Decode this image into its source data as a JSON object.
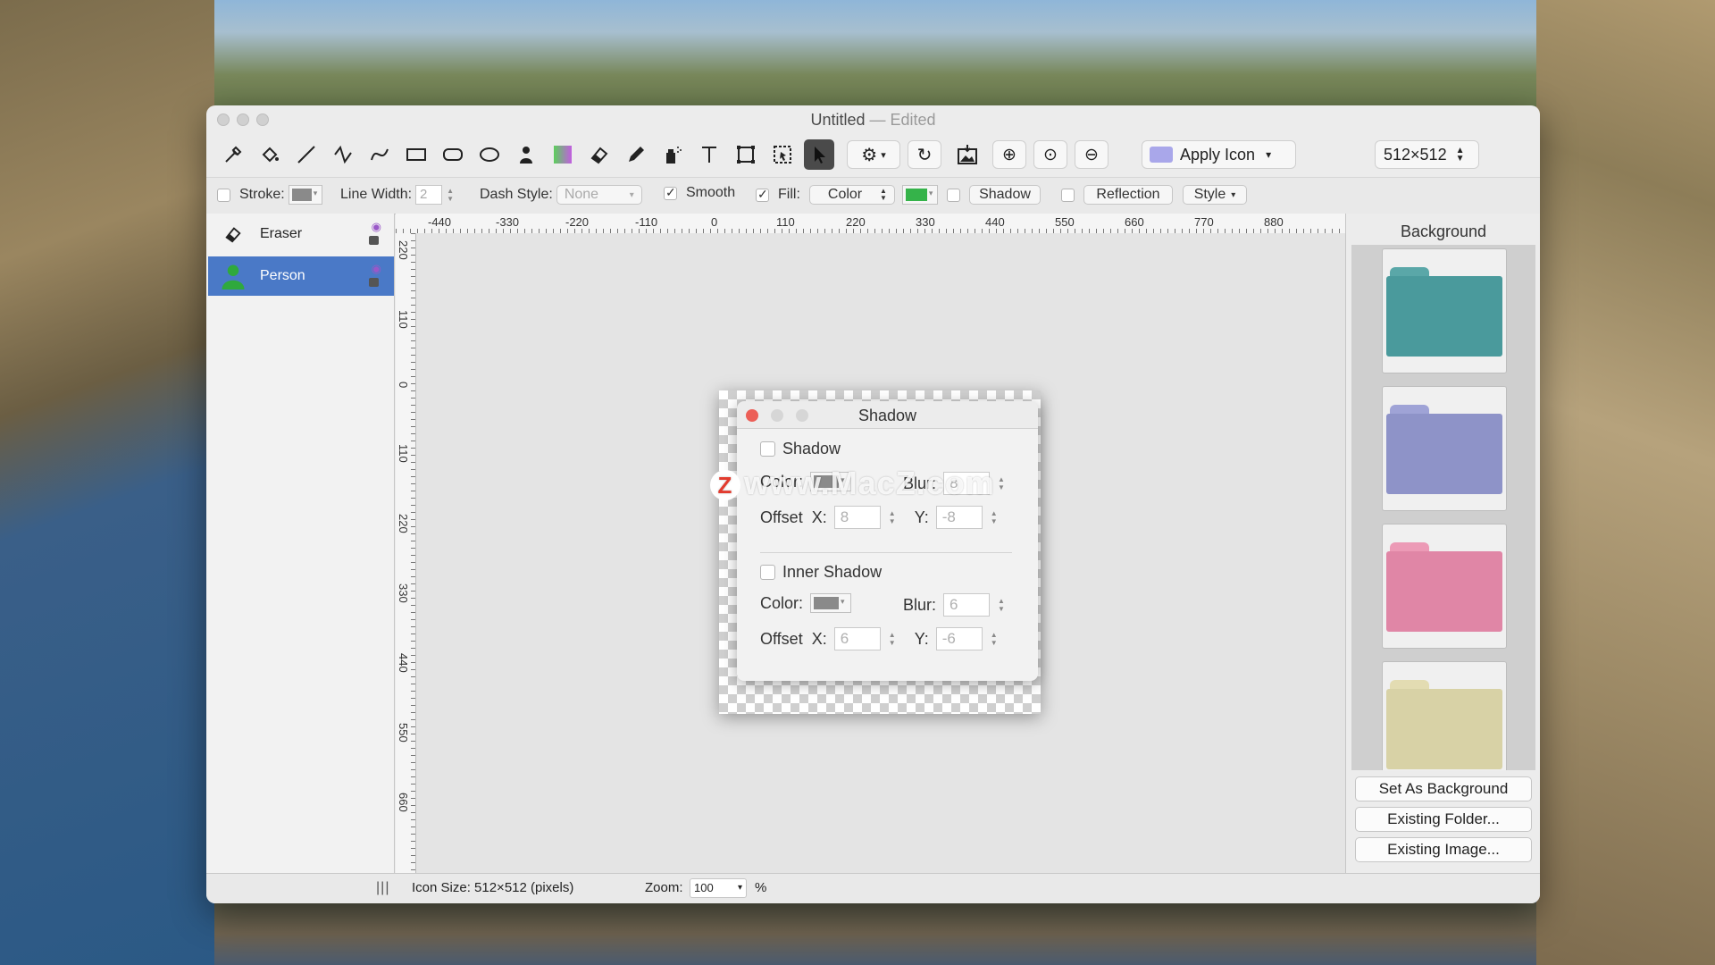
{
  "window": {
    "title": "Untitled",
    "title_status": "— Edited"
  },
  "toolbar": {
    "apply_icon_label": "Apply Icon",
    "size_label": "512×512",
    "tools": [
      "eyedropper-icon",
      "paint-bucket-icon",
      "line-icon",
      "polyline-icon",
      "curve-icon",
      "rectangle-icon",
      "rounded-rect-icon",
      "ellipse-icon",
      "person-icon",
      "gradient-icon",
      "eraser-icon",
      "pencil-icon",
      "spray-icon",
      "text-icon",
      "transform-icon",
      "selection-icon",
      "arrow-icon"
    ]
  },
  "options": {
    "stroke_label": "Stroke:",
    "line_width_label": "Line Width:",
    "line_width_value": "2",
    "dash_style_label": "Dash Style:",
    "dash_style_value": "None",
    "smooth_label": "Smooth",
    "fill_label": "Fill:",
    "fill_value": "Color",
    "shadow_label": "Shadow",
    "reflection_label": "Reflection",
    "style_label": "Style",
    "fill_color": "#35b34a"
  },
  "layers": [
    {
      "name": "Eraser",
      "selected": false
    },
    {
      "name": "Person",
      "selected": true
    }
  ],
  "ruler": {
    "h_ticks": [
      "-440",
      "-330",
      "-220",
      "-110",
      "0",
      "110",
      "220",
      "330",
      "440",
      "550",
      "660",
      "770",
      "880"
    ],
    "v_ticks": [
      "220",
      "110",
      "0",
      "110",
      "220",
      "330",
      "440",
      "550",
      "660"
    ]
  },
  "background_panel": {
    "title": "Background",
    "folders": [
      {
        "color": "#4a9a9c",
        "tab": "#5aa7a8"
      },
      {
        "color": "#8e93c8",
        "tab": "#9fa3d6"
      },
      {
        "color": "#e086a6",
        "tab": "#ec9ab6"
      },
      {
        "color": "#d8d2a6",
        "tab": "#e3dcb2"
      }
    ],
    "set_bg_label": "Set As Background",
    "existing_folder_label": "Existing Folder...",
    "existing_image_label": "Existing Image..."
  },
  "status": {
    "icon_size": "Icon Size: 512×512 (pixels)",
    "zoom_label": "Zoom:",
    "zoom_value": "100",
    "zoom_unit": "%"
  },
  "shadow_dialog": {
    "title": "Shadow",
    "shadow_label": "Shadow",
    "color_label": "Color:",
    "blur_label": "Blur:",
    "blur_value": "8",
    "offset_label": "Offset",
    "x_label": "X:",
    "offset_x": "8",
    "y_label": "Y:",
    "offset_y": "-8",
    "inner_shadow_label": "Inner Shadow",
    "inner_color_label": "Color:",
    "inner_blur_label": "Blur:",
    "inner_blur_value": "6",
    "inner_offset_label": "Offset",
    "inner_x_label": "X:",
    "inner_offset_x": "6",
    "inner_y_label": "Y:",
    "inner_offset_y": "-6"
  },
  "watermark": "www.MacZ.com",
  "watermark_logo": "Z"
}
